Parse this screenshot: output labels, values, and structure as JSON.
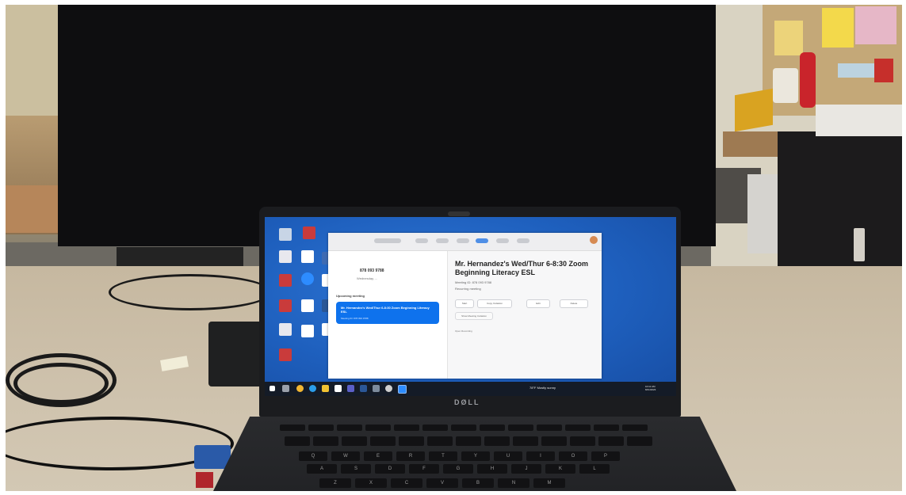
{
  "window": {
    "meeting_id": "878 093 9788",
    "meeting_date": "Wednesday, ...",
    "upcoming_label": "Upcoming meeting",
    "card_title": "Mr. Hernandez's Wed/Thur 6-8:30 Zoom Beginning Literacy ESL",
    "card_meta": "Meeting ID: 878 093 9788",
    "title": "Mr. Hernandez's Wed/Thur 6-8:30 Zoom Beginning Literacy ESL",
    "subtitle": "Meeting ID: 878 093 9788",
    "subtitle2": "Recurring meeting",
    "btn_start": "Start",
    "btn_copy": "Copy Invitation",
    "btn_edit": "Edit",
    "btn_delete": "Delete",
    "btn_more": "Show Meeting Invitation",
    "link": "Open Recording",
    "footer": "Open Zoom"
  },
  "taskbar": {
    "weather": "78°F Mostly sunny",
    "clock": "10:11 AM",
    "date": "8/21/2023"
  },
  "laptop": {
    "brand": "DØLL"
  },
  "keyboard": {
    "row1": [
      "Q",
      "W",
      "E",
      "R",
      "T",
      "Y",
      "U",
      "I",
      "O",
      "P"
    ],
    "row2": [
      "A",
      "S",
      "D",
      "F",
      "G",
      "H",
      "J",
      "K",
      "L"
    ],
    "row3": [
      "Z",
      "X",
      "C",
      "V",
      "B",
      "N",
      "M"
    ]
  },
  "colors": {
    "desktop_blue": "#1e5fbd",
    "zoom_blue": "#0e72ed",
    "taskbar": "#141b27"
  },
  "icons": [
    "recycle-bin-icon",
    "pdf-icon",
    "zoom-icon",
    "word-icon",
    "folder-icon",
    "chrome-icon",
    "file-explorer-icon",
    "edge-icon",
    "start-icon"
  ]
}
